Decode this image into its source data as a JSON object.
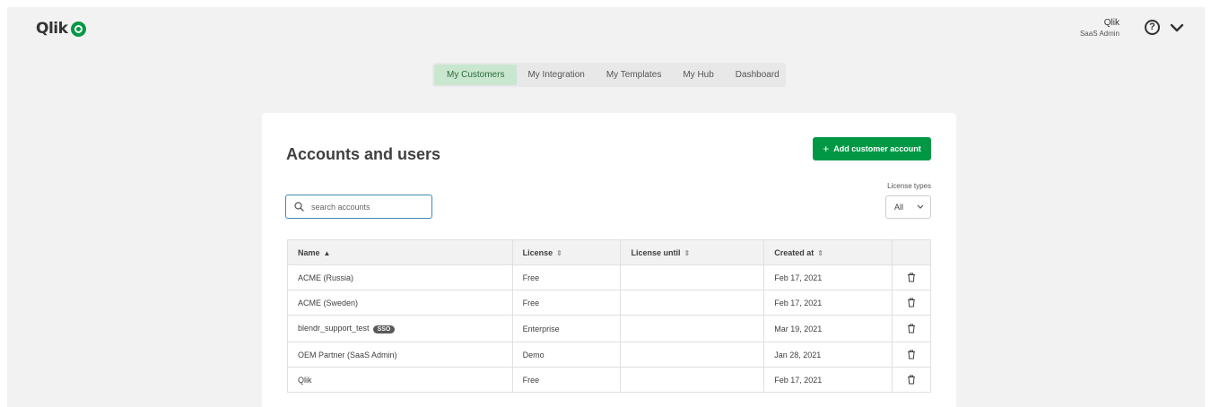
{
  "app": {
    "logo_text": "Qlik"
  },
  "user": {
    "name": "Qlik",
    "role": "SaaS Admin"
  },
  "help_icon": "question-circle-icon",
  "menu_icon": "chevron-down-icon",
  "nav": {
    "tabs": [
      {
        "label": "My Customers",
        "active": true
      },
      {
        "label": "My Integration",
        "active": false
      },
      {
        "label": "My Templates",
        "active": false
      },
      {
        "label": "My Hub",
        "active": false
      },
      {
        "label": "Dashboard",
        "active": false
      }
    ]
  },
  "main": {
    "title": "Accounts and users",
    "add_button": {
      "icon": "+",
      "label": "Add customer account"
    },
    "search": {
      "placeholder": "search accounts",
      "value": ""
    },
    "license_filter": {
      "label": "License types",
      "value": "All"
    }
  },
  "table": {
    "columns": [
      {
        "label": "Name",
        "sort": "asc"
      },
      {
        "label": "License",
        "sort": "none"
      },
      {
        "label": "License until",
        "sort": "none"
      },
      {
        "label": "Created at",
        "sort": "none"
      }
    ],
    "rows": [
      {
        "name": "ACME (Russia)",
        "badge": "",
        "license": "Free",
        "license_until": "",
        "created_at": "Feb 17, 2021"
      },
      {
        "name": "ACME (Sweden)",
        "badge": "",
        "license": "Free",
        "license_until": "",
        "created_at": "Feb 17, 2021"
      },
      {
        "name": "blendr_support_test",
        "badge": "SSO",
        "license": "Enterprise",
        "license_until": "",
        "created_at": "Mar 19, 2021"
      },
      {
        "name": "OEM Partner (SaaS Admin)",
        "badge": "",
        "license": "Demo",
        "license_until": "",
        "created_at": "Jan 28, 2021"
      },
      {
        "name": "Qlik",
        "badge": "",
        "license": "Free",
        "license_until": "",
        "created_at": "Feb 17, 2021"
      }
    ]
  },
  "colors": {
    "brand_green": "#009845",
    "active_tab_bg": "#c9e6cf",
    "focus_border": "#3f8ab3",
    "background": "#f2f2f2"
  }
}
